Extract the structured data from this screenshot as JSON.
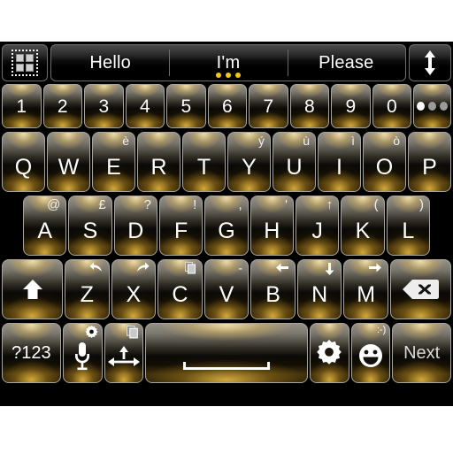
{
  "theme": {
    "background": "#ffffff",
    "keyboard_bg": "#000000",
    "accent": "#f5c518",
    "key_gold": "#d6b056",
    "key_text": "#ffffff"
  },
  "candidate_bar": {
    "menu_icon": "grid-icon",
    "resize_icon": "vertical-resize-arrow-icon",
    "suggestions": [
      {
        "text": "Hello",
        "has_dots": false
      },
      {
        "text": "I'm",
        "has_dots": true
      },
      {
        "text": "Please",
        "has_dots": false
      }
    ],
    "dot_count": 3
  },
  "rows": {
    "numbers": {
      "keys": [
        {
          "main": "1"
        },
        {
          "main": "2"
        },
        {
          "main": "3"
        },
        {
          "main": "4"
        },
        {
          "main": "5"
        },
        {
          "main": "6"
        },
        {
          "main": "7"
        },
        {
          "main": "8"
        },
        {
          "main": "9"
        },
        {
          "main": "0"
        }
      ],
      "more_key": {
        "icon": "three-dots-icon",
        "label": ""
      }
    },
    "qwerty": [
      {
        "main": "Q",
        "alt": ""
      },
      {
        "main": "W",
        "alt": ""
      },
      {
        "main": "E",
        "alt": "è"
      },
      {
        "main": "R",
        "alt": ""
      },
      {
        "main": "T",
        "alt": ""
      },
      {
        "main": "Y",
        "alt": "ý"
      },
      {
        "main": "U",
        "alt": "ù"
      },
      {
        "main": "I",
        "alt": "ì"
      },
      {
        "main": "O",
        "alt": "ò"
      },
      {
        "main": "P",
        "alt": ""
      }
    ],
    "asdf": [
      {
        "main": "A",
        "alt": "@"
      },
      {
        "main": "S",
        "alt": "£"
      },
      {
        "main": "D",
        "alt": "?"
      },
      {
        "main": "F",
        "alt": "!"
      },
      {
        "main": "G",
        "alt": ","
      },
      {
        "main": "H",
        "alt": "'"
      },
      {
        "main": "J",
        "alt": "↑"
      },
      {
        "main": "K",
        "alt": "("
      },
      {
        "main": "L",
        "alt": ")"
      }
    ],
    "zxcv": {
      "shift": {
        "icon": "shift-arrow-icon"
      },
      "keys": [
        {
          "main": "Z",
          "alt_icon": "undo-arrow-icon",
          "alt": ""
        },
        {
          "main": "X",
          "alt_icon": "redo-arrow-icon",
          "alt": ""
        },
        {
          "main": "C",
          "alt_icon": "copy-icon",
          "alt": ""
        },
        {
          "main": "V",
          "alt_icon": "",
          "alt": "-"
        },
        {
          "main": "B",
          "alt_icon": "arrow-left-icon",
          "alt": ""
        },
        {
          "main": "N",
          "alt_icon": "arrow-down-icon",
          "alt": ""
        },
        {
          "main": "M",
          "alt_icon": "arrow-right-icon",
          "alt": ""
        }
      ],
      "backspace": {
        "icon": "backspace-icon"
      }
    },
    "bottom": {
      "symbols": {
        "label": "?123"
      },
      "mic": {
        "icon": "microphone-icon",
        "badge": "gear-badge-icon"
      },
      "navigate": {
        "icon": "move-arrows-icon",
        "badge": "copy-badge-icon"
      },
      "space": {
        "icon": "spacebar-icon",
        "label": ""
      },
      "settings": {
        "icon": "gear-icon"
      },
      "emoji": {
        "icon": "smiley-icon",
        "badge": ":-)"
      },
      "enter": {
        "label": "Next"
      }
    }
  }
}
